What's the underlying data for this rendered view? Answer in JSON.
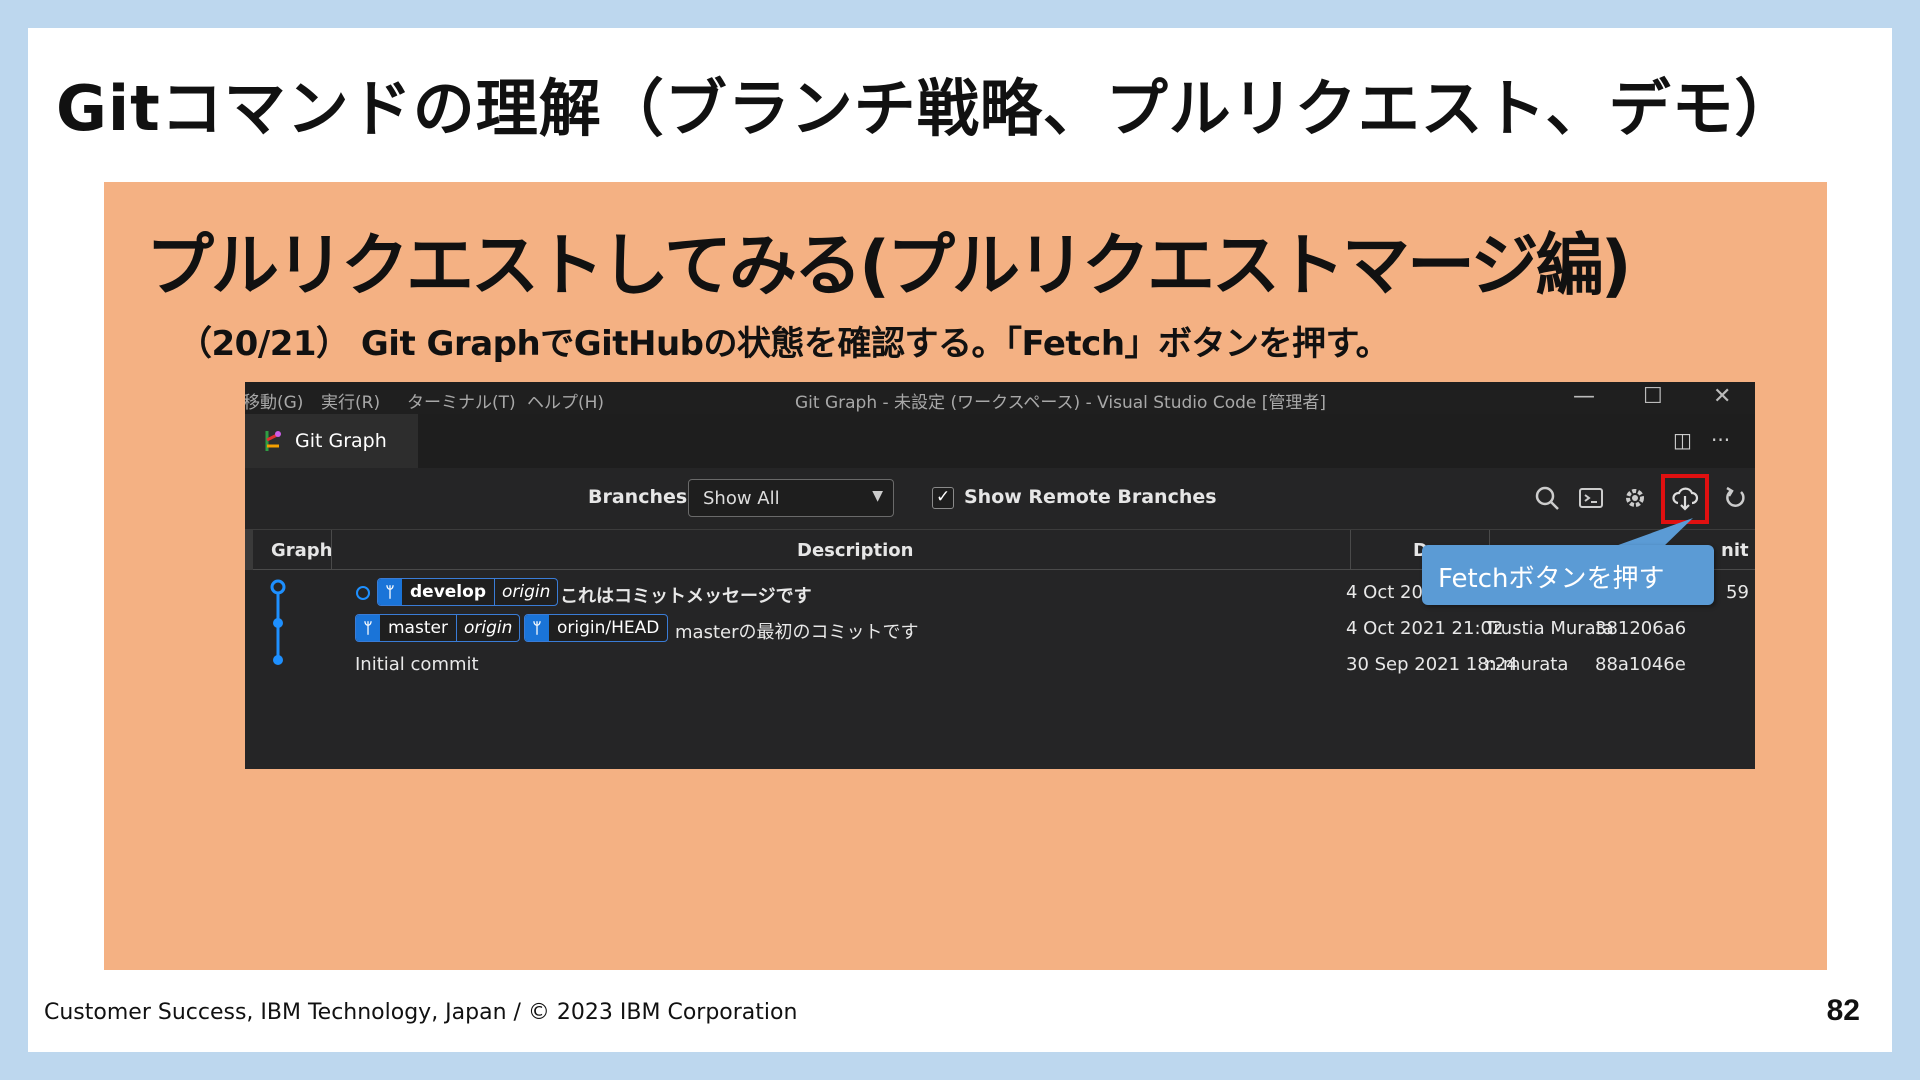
{
  "slide": {
    "title": "Gitコマンドの理解（ブランチ戦略、プルリクエスト、デモ）",
    "heading": "プルリクエストしてみる(プルリクエストマージ編)",
    "subheading": "（20/21） Git GraphでGitHubの状態を確認する。「Fetch」ボタンを押す。",
    "footer": "Customer Success, IBM Technology, Japan / © 2023 IBM Corporation",
    "page_number": "82"
  },
  "vscode": {
    "menu": [
      "移動(G)",
      "実行(R)",
      "ターミナル(T)",
      "ヘルプ(H)"
    ],
    "window_title": "Git Graph - 未設定 (ワークスペース) - Visual Studio Code [管理者]",
    "window_controls": {
      "minimize": "—",
      "maximize": "☐",
      "close": "✕"
    },
    "tab": {
      "label": "Git Graph",
      "icon": "git-graph-icon"
    },
    "tab_actions": {
      "split": "◫",
      "more": "···"
    },
    "controls": {
      "branches_label": "Branches:",
      "branches_value": "Show All",
      "show_remote_label": "Show Remote Branches",
      "show_remote_checked": true,
      "icons": [
        "search-icon",
        "terminal-icon",
        "settings-icon",
        "fetch-icon",
        "refresh-icon"
      ]
    },
    "table": {
      "headers": {
        "graph": "Graph",
        "description": "Description",
        "date": "D",
        "commit": "nit"
      },
      "rows": [
        {
          "refs": [
            {
              "name": "develop",
              "remote": "origin",
              "bold": true
            }
          ],
          "message": "これはコミットメッセージです",
          "date": "4 Oct 20",
          "author": "",
          "commit": "59"
        },
        {
          "refs": [
            {
              "name": "master",
              "remote": "origin"
            },
            {
              "name": "origin/HEAD"
            }
          ],
          "message": "masterの最初のコミットです",
          "date": "4 Oct 2021 21:02",
          "author": "Trustia Murata",
          "commit": "381206a6"
        },
        {
          "refs": [],
          "message": "Initial commit",
          "date": "30 Sep 2021 18:24",
          "author": "n-murata",
          "commit": "88a1046e"
        }
      ]
    },
    "callout": "Fetchボタンを押す",
    "colors": {
      "accent": "#1a74d8",
      "highlight": "#e01010",
      "callout": "#5b9bd5"
    }
  }
}
